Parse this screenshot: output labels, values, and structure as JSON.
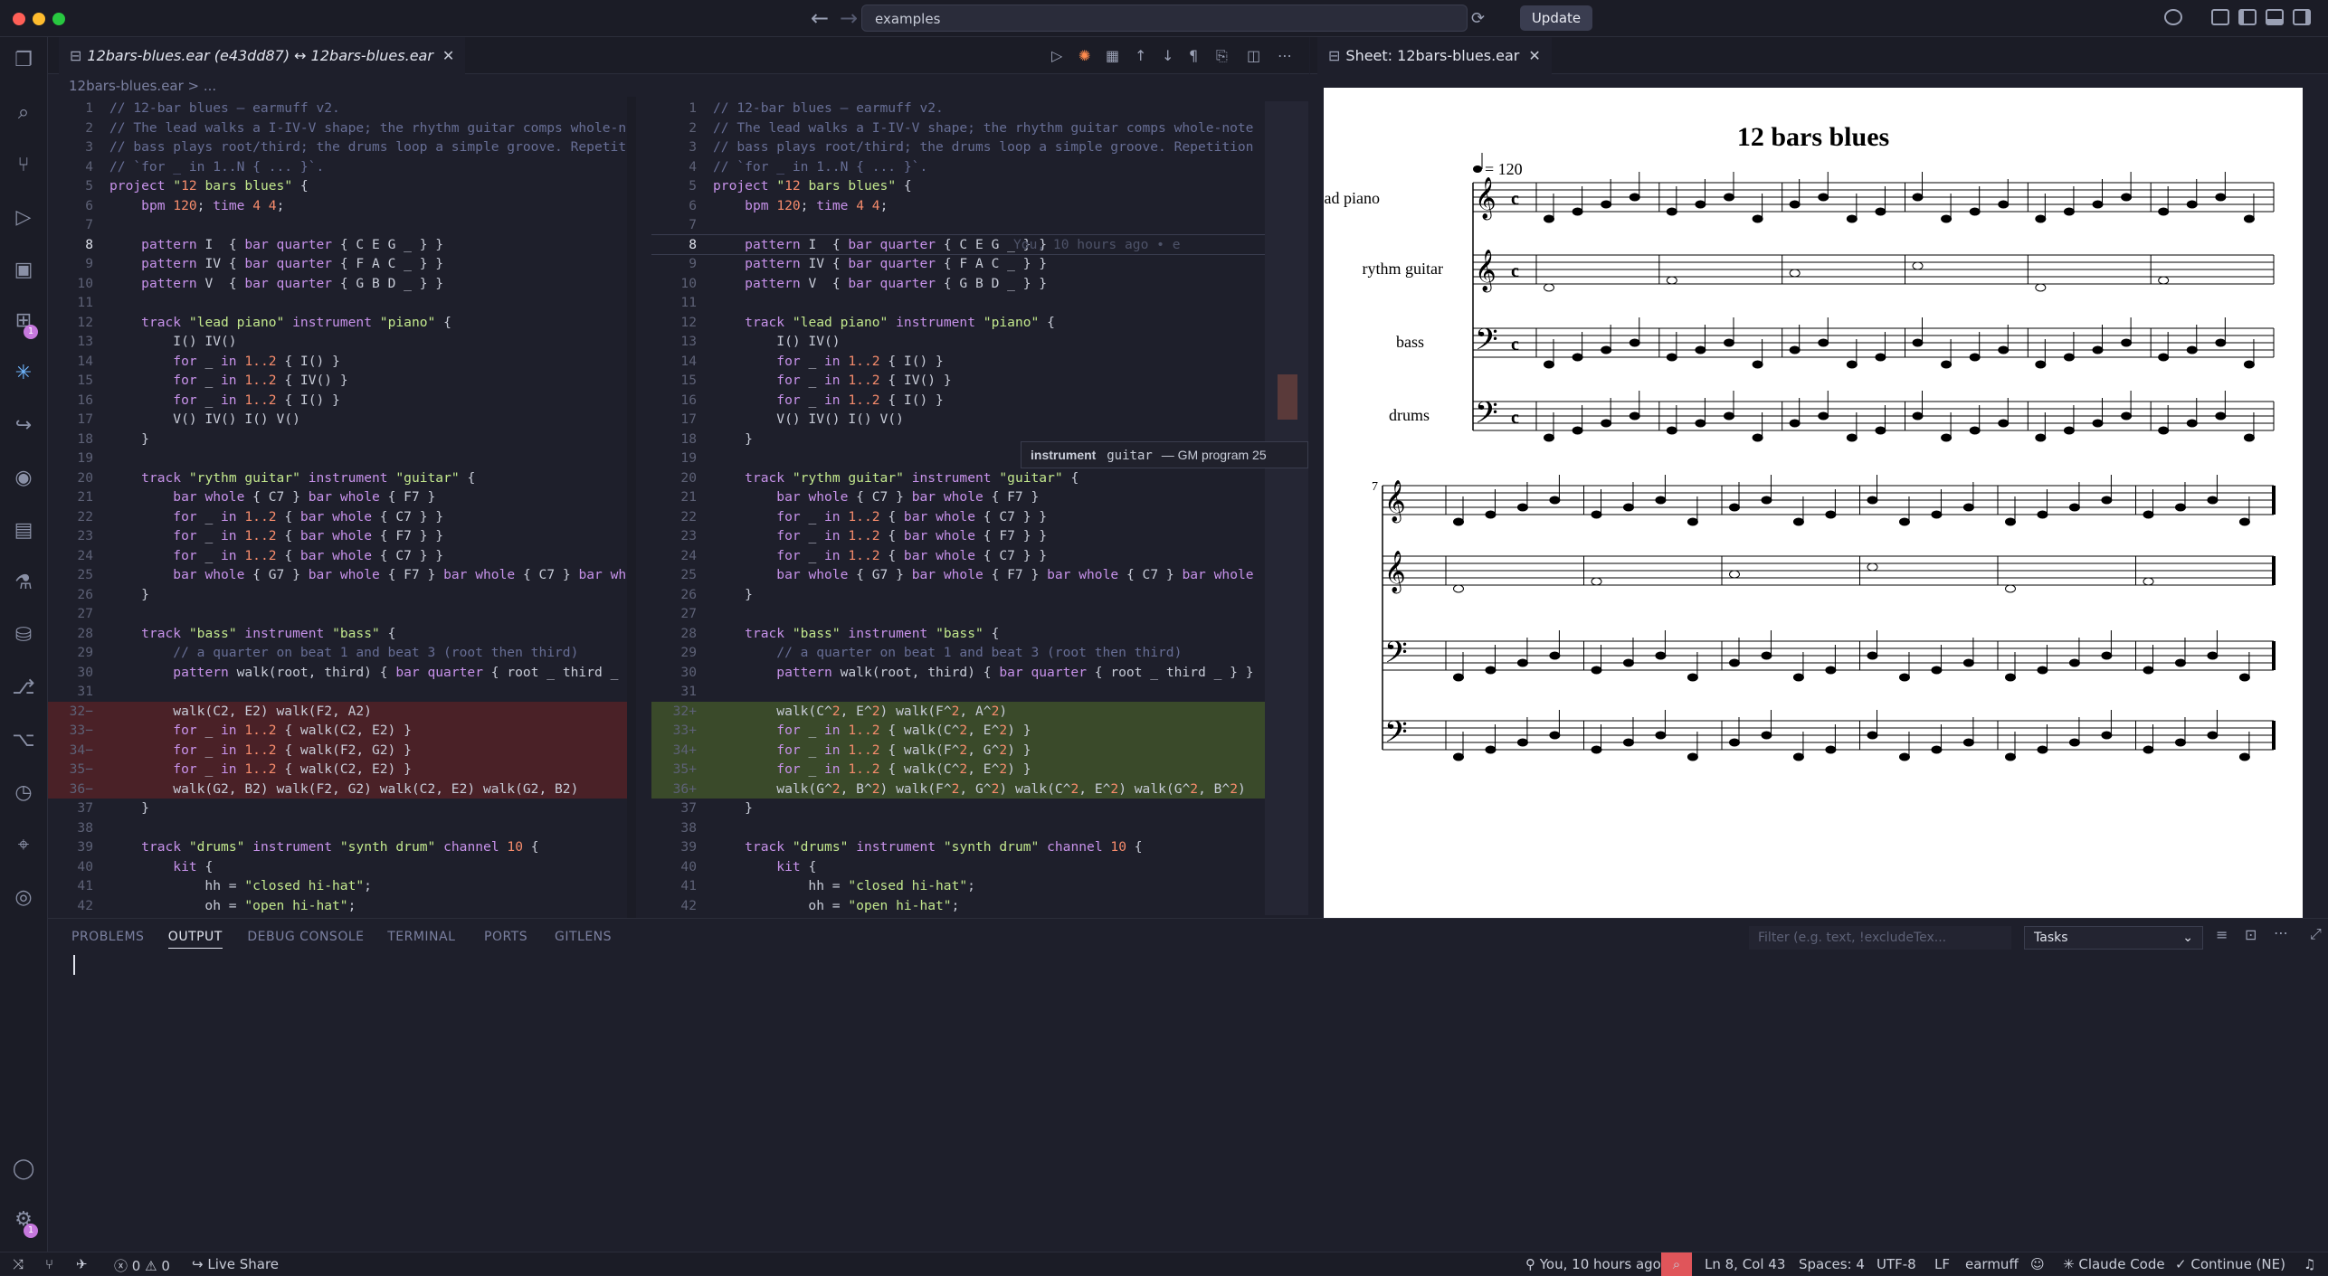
{
  "window": {
    "search_text": "examples",
    "update_label": "Update"
  },
  "tabs": {
    "left_tab": "12bars-blues.ear (e43dd87) ↔ 12bars-blues.ear",
    "right_tab": "Sheet: 12bars-blues.ear"
  },
  "breadcrumb": "12bars-blues.ear > ...",
  "activity_badges": {
    "extensions": "1",
    "settings": "1"
  },
  "editor": {
    "lines": [
      {
        "n": "1",
        "t": "// 12-bar blues — earmuff v2.",
        "cls": "c"
      },
      {
        "n": "2",
        "t": "// The lead walks a I-IV-V shape; the rhythm guitar comps whole-note",
        "cls": "c"
      },
      {
        "n": "3",
        "t": "// bass plays root/third; the drums loop a simple groove. Repetition",
        "cls": "c"
      },
      {
        "n": "4",
        "t": "// `for _ in 1..N { ... }`.",
        "cls": "c"
      },
      {
        "n": "5",
        "t": "project \"12 bars blues\" {",
        "cls": ""
      },
      {
        "n": "6",
        "t": "    bpm 120; time 4 4;",
        "cls": ""
      },
      {
        "n": "7",
        "t": "",
        "cls": ""
      },
      {
        "n": "8",
        "t": "    pattern I  { bar quarter { C E G _ } }",
        "cls": ""
      },
      {
        "n": "9",
        "t": "    pattern IV { bar quarter { F A C _ } }",
        "cls": ""
      },
      {
        "n": "10",
        "t": "    pattern V  { bar quarter { G B D _ } }",
        "cls": ""
      },
      {
        "n": "11",
        "t": "",
        "cls": ""
      },
      {
        "n": "12",
        "t": "    track \"lead piano\" instrument \"piano\" {",
        "cls": ""
      },
      {
        "n": "13",
        "t": "        I() IV()",
        "cls": ""
      },
      {
        "n": "14",
        "t": "        for _ in 1..2 { I() }",
        "cls": ""
      },
      {
        "n": "15",
        "t": "        for _ in 1..2 { IV() }",
        "cls": ""
      },
      {
        "n": "16",
        "t": "        for _ in 1..2 { I() }",
        "cls": ""
      },
      {
        "n": "17",
        "t": "        V() IV() I() V()",
        "cls": ""
      },
      {
        "n": "18",
        "t": "    }",
        "cls": ""
      },
      {
        "n": "19",
        "t": "",
        "cls": ""
      },
      {
        "n": "20",
        "t": "    track \"rythm guitar\" instrument \"guitar\" {",
        "cls": ""
      },
      {
        "n": "21",
        "t": "        bar whole { C7 } bar whole { F7 }",
        "cls": ""
      },
      {
        "n": "22",
        "t": "        for _ in 1..2 { bar whole { C7 } }",
        "cls": ""
      },
      {
        "n": "23",
        "t": "        for _ in 1..2 { bar whole { F7 } }",
        "cls": ""
      },
      {
        "n": "24",
        "t": "        for _ in 1..2 { bar whole { C7 } }",
        "cls": ""
      },
      {
        "n": "25",
        "t": "        bar whole { G7 } bar whole { F7 } bar whole { C7 } bar whole",
        "cls": ""
      },
      {
        "n": "26",
        "t": "    }",
        "cls": ""
      },
      {
        "n": "27",
        "t": "",
        "cls": ""
      },
      {
        "n": "28",
        "t": "    track \"bass\" instrument \"bass\" {",
        "cls": ""
      },
      {
        "n": "29",
        "t": "        // a quarter on beat 1 and beat 3 (root then third)",
        "cls": "c"
      },
      {
        "n": "30",
        "t": "        pattern walk(root, third) { bar quarter { root _ third _ } }",
        "cls": ""
      },
      {
        "n": "31",
        "t": "",
        "cls": ""
      },
      {
        "n": "32",
        "t": "        walk(C2, E2) walk(F2, A2)",
        "cls": "",
        "diff": true
      },
      {
        "n": "33",
        "t": "        for _ in 1..2 { walk(C2, E2) }",
        "cls": "",
        "diff": true
      },
      {
        "n": "34",
        "t": "        for _ in 1..2 { walk(F2, G2) }",
        "cls": "",
        "diff": true
      },
      {
        "n": "35",
        "t": "        for _ in 1..2 { walk(C2, E2) }",
        "cls": "",
        "diff": true
      },
      {
        "n": "36",
        "t": "        walk(G2, B2) walk(F2, G2) walk(C2, E2) walk(G2, B2)",
        "cls": "",
        "diff": true
      },
      {
        "n": "37",
        "t": "    }",
        "cls": ""
      },
      {
        "n": "38",
        "t": "",
        "cls": ""
      },
      {
        "n": "39",
        "t": "    track \"drums\" instrument \"synth drum\" channel 10 {",
        "cls": ""
      },
      {
        "n": "40",
        "t": "        kit {",
        "cls": ""
      },
      {
        "n": "41",
        "t": "            hh = \"closed hi-hat\";",
        "cls": ""
      },
      {
        "n": "42",
        "t": "            oh = \"open hi-hat\";",
        "cls": ""
      }
    ],
    "right_diff_lines": {
      "32": "        walk(C^2, E^2) walk(F^2, A^2)",
      "33": "        for _ in 1..2 { walk(C^2, E^2) }",
      "34": "        for _ in 1..2 { walk(F^2, G^2) }",
      "35": "        for _ in 1..2 { walk(C^2, E^2) }",
      "36": "        walk(G^2, B^2) walk(F^2, G^2) walk(C^2, E^2) walk(G^2, B^2)"
    },
    "blame_text": "You, 10 hours ago • e",
    "hover": {
      "keyword": "instrument",
      "value": "guitar",
      "detail": "— GM program 25"
    }
  },
  "sheet": {
    "title": "12 bars blues",
    "tempo": "= 120",
    "instruments": [
      "lead piano",
      "rythm guitar",
      "bass",
      "drums"
    ],
    "measure_number": "7"
  },
  "panel": {
    "tabs": [
      "PROBLEMS",
      "OUTPUT",
      "DEBUG CONSOLE",
      "TERMINAL",
      "PORTS",
      "GITLENS"
    ],
    "active_tab": "OUTPUT",
    "filter_placeholder": "Filter (e.g. text, !excludeTex...",
    "tasks_select": "Tasks"
  },
  "status": {
    "errors": "0",
    "warnings": "0",
    "live_share": "Live Share",
    "blame": "You, 10 hours ago",
    "position": "Ln 8, Col 43",
    "spaces": "Spaces: 4",
    "encoding": "UTF-8",
    "eol": "LF",
    "language": "earmuff",
    "claude": "Claude Code",
    "continue": "Continue (NE)"
  },
  "colors": {
    "accent": "#c678dd",
    "diff_del": "#4a2127",
    "diff_add": "#3a4a2a"
  }
}
